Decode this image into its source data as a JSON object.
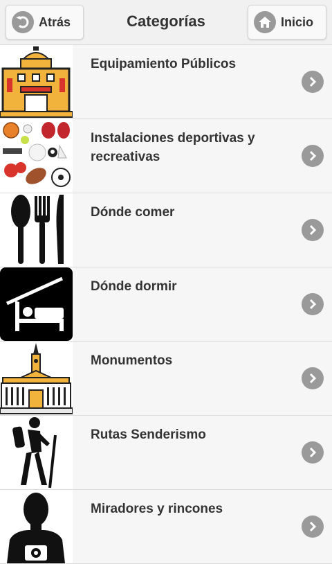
{
  "header": {
    "back_label": "Atrás",
    "title": "Categorías",
    "home_label": "Inicio"
  },
  "categories": [
    {
      "label": "Equipamiento Públicos",
      "icon": "public-building-icon"
    },
    {
      "label": "Instalaciones deportivas y recreativas",
      "icon": "sports-balls-icon"
    },
    {
      "label": "Dónde comer",
      "icon": "cutlery-icon"
    },
    {
      "label": "Dónde dormir",
      "icon": "bed-icon"
    },
    {
      "label": "Monumentos",
      "icon": "monument-icon"
    },
    {
      "label": "Rutas Senderismo",
      "icon": "hiker-icon"
    },
    {
      "label": "Miradores y rincones",
      "icon": "photographer-icon"
    }
  ],
  "colors": {
    "chevron_bg": "#9a9a9a",
    "header_bg": "#f1f1f1",
    "row_bg": "#f6f6f6"
  }
}
